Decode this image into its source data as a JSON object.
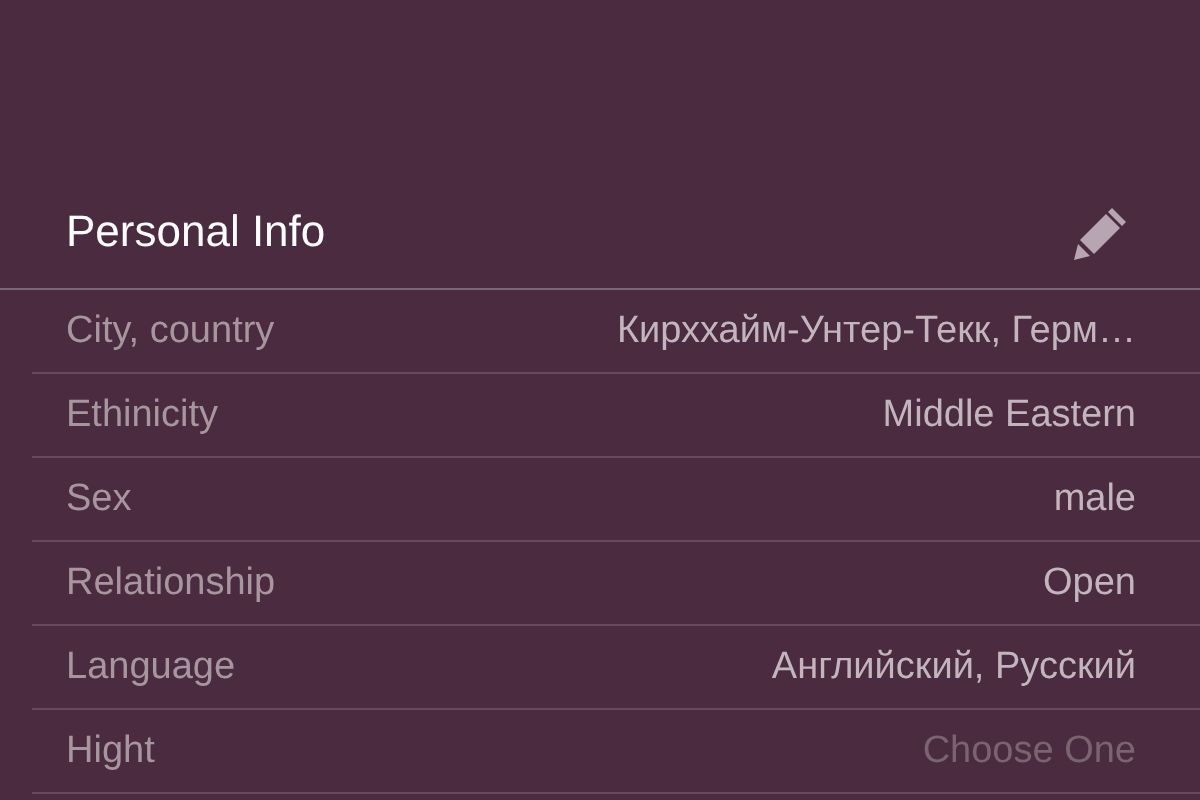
{
  "section": {
    "title": "Personal Info"
  },
  "rows": [
    {
      "label": "City, country",
      "value": "Кирххайм-Унтер-Текк, Герм…"
    },
    {
      "label": "Ethinicity",
      "value": "Middle Eastern"
    },
    {
      "label": "Sex",
      "value": "male"
    },
    {
      "label": "Relationship",
      "value": "Open"
    },
    {
      "label": "Language",
      "value": "Английский, Русский"
    },
    {
      "label": "Hight",
      "placeholder": "Choose One"
    }
  ]
}
